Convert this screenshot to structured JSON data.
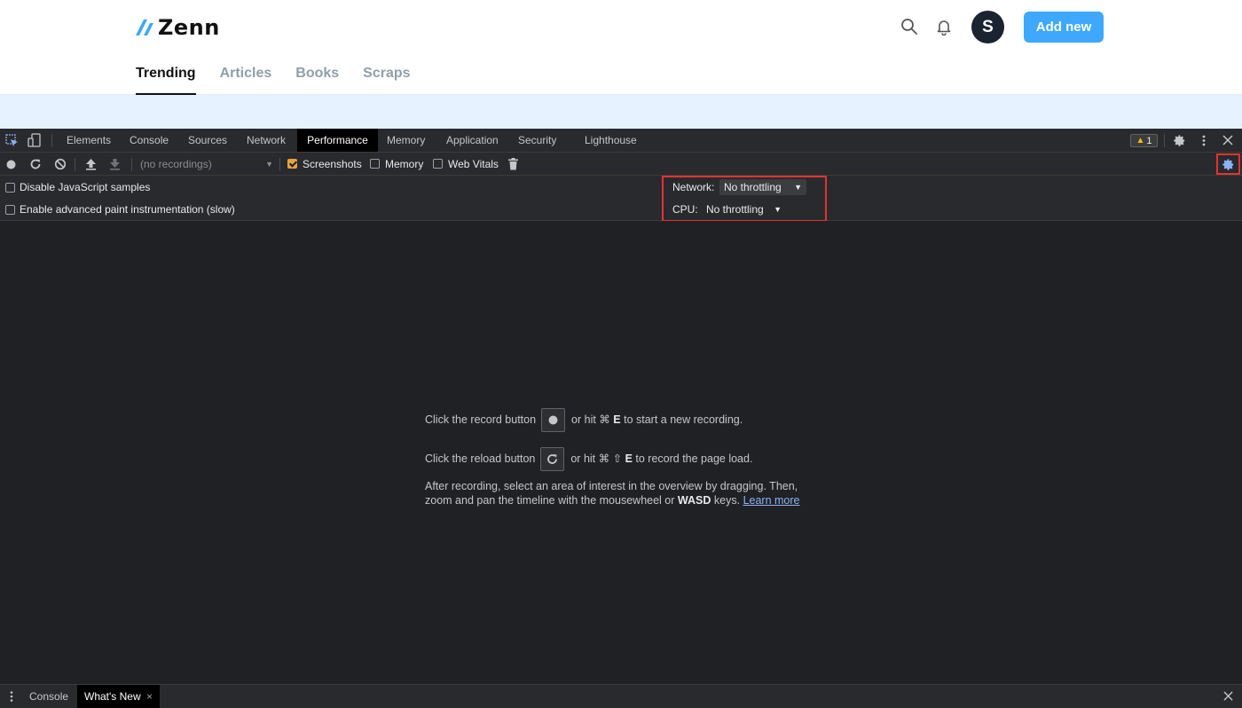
{
  "site": {
    "logo_text": "Zenn",
    "brand_color": "#3ea8ff",
    "avatar_letter": "S",
    "add_new_label": "Add new",
    "tabs": [
      "Trending",
      "Articles",
      "Books",
      "Scraps"
    ],
    "active_tab": "Trending"
  },
  "devtools": {
    "panel_tabs": [
      "Elements",
      "Console",
      "Sources",
      "Network",
      "Performance",
      "Memory",
      "Application",
      "Security",
      "Lighthouse"
    ],
    "active_panel": "Performance",
    "warning_count": "1",
    "toolbar": {
      "recordings_placeholder": "(no recordings)",
      "screenshots_label": "Screenshots",
      "screenshots_checked": true,
      "memory_label": "Memory",
      "memory_checked": false,
      "web_vitals_label": "Web Vitals",
      "web_vitals_checked": false
    },
    "settings": {
      "disable_js_samples_label": "Disable JavaScript samples",
      "advanced_paint_label": "Enable advanced paint instrumentation (slow)",
      "network_label": "Network:",
      "network_value": "No throttling",
      "cpu_label": "CPU:",
      "cpu_value": "No throttling"
    },
    "hints": {
      "record_before": "Click the record button",
      "record_after_prefix": "or hit ⌘",
      "record_key": "E",
      "record_after": "to start a new recording.",
      "reload_before": "Click the reload button",
      "reload_after_prefix": "or hit ⌘ ⇧",
      "reload_key": "E",
      "reload_after": "to record the page load.",
      "para_line1": "After recording, select an area of interest in the overview by dragging. Then,",
      "para_line2_prefix": "zoom and pan the timeline with the mousewheel or",
      "para_line2_key": "WASD",
      "para_line2_suffix": "keys.",
      "learn_more": "Learn more"
    },
    "drawer": {
      "tabs": [
        "Console",
        "What's New"
      ],
      "active_tab": "What's New"
    },
    "highlight_color": "#e5322d",
    "checkbox_accent": "#e8a33d"
  }
}
